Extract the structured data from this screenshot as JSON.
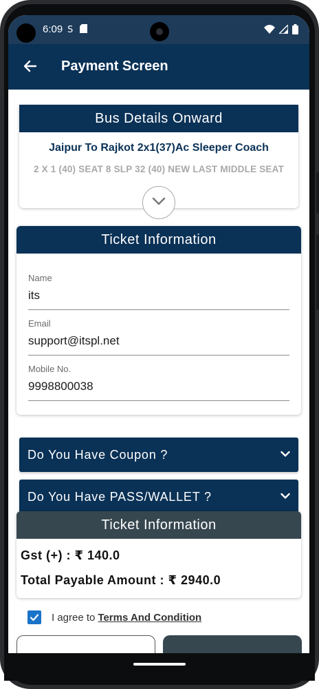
{
  "status_bar": {
    "time": "6:09",
    "icons": [
      "sync-status-icon",
      "sd-card-icon",
      "wifi-icon",
      "signal-icon",
      "battery-icon"
    ]
  },
  "app_bar": {
    "title": "Payment Screen",
    "back_icon": "arrow-back-icon"
  },
  "bus_details": {
    "header": "Bus Details Onward",
    "route": "Jaipur To Rajkot 2x1(37)Ac Sleeper Coach",
    "bus_type": "2 X 1 (40) SEAT 8 SLP 32 (40) NEW LAST MIDDLE SEAT",
    "expand_icon": "chevron-down-icon"
  },
  "ticket_info": {
    "header": "Ticket Information",
    "fields": [
      {
        "label": "Name",
        "value": "its"
      },
      {
        "label": "Email",
        "value": "support@itspl.net"
      },
      {
        "label": "Mobile No.",
        "value": "9998800038"
      }
    ]
  },
  "coupon": {
    "label": "Do You Have Coupon ?",
    "icon": "chevron-down-icon"
  },
  "wallet": {
    "label": "Do You Have PASS/WALLET ?",
    "icon": "chevron-down-icon"
  },
  "summary": {
    "header": "Ticket Information",
    "gst": "Gst (+) : ₹ 140.0",
    "total": "Total Payable Amount : ₹ 2940.0"
  },
  "agree": {
    "checked": true,
    "text": "I agree to",
    "link": "Terms And Condition"
  },
  "colors": {
    "primary": "#0a3156",
    "secondary": "#37474f",
    "checkbox": "#1a73c9"
  }
}
